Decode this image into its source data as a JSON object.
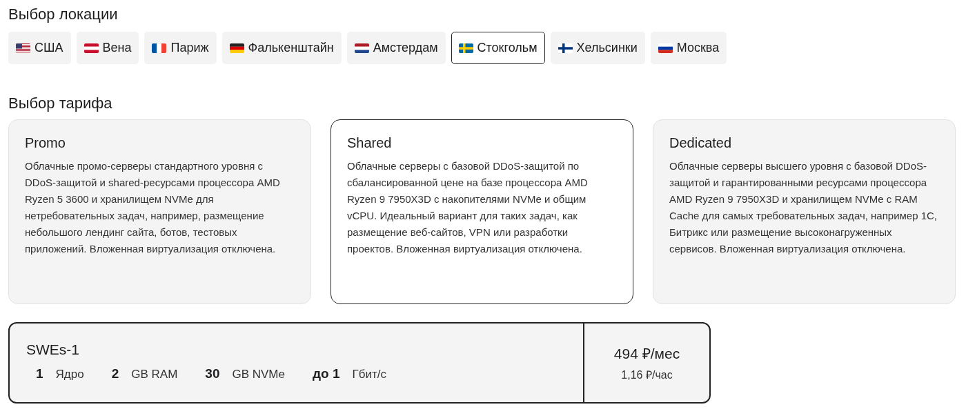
{
  "locations_title": "Выбор локации",
  "locations": [
    {
      "label": "США",
      "selected": false
    },
    {
      "label": "Вена",
      "selected": false
    },
    {
      "label": "Париж",
      "selected": false
    },
    {
      "label": "Фалькенштайн",
      "selected": false
    },
    {
      "label": "Амстердам",
      "selected": false
    },
    {
      "label": "Стокгольм",
      "selected": true
    },
    {
      "label": "Хельсинки",
      "selected": false
    },
    {
      "label": "Москва",
      "selected": false
    }
  ],
  "tariffs_title": "Выбор тарифа",
  "tariffs": [
    {
      "title": "Promo",
      "description": "Облачные промо-серверы стандартного уровня с DDoS-защитой и shared-ресурсами процессора AMD Ryzen 5 3600 и хранилищем NVMe для нетребовательных задач, например, размещение небольшого лендинг сайта, ботов, тестовых приложений. Вложенная виртуализация отключена.",
      "selected": false
    },
    {
      "title": "Shared",
      "description": "Облачные серверы с базовой DDoS-защитой по сбалансированной цене на базе процессора AMD Ryzen 9 7950X3D с накопителями NVMe и общим vCPU. Идеальный вариант для таких задач, как размещение веб-сайтов, VPN или разработки проектов. Вложенная виртуализация отключена.",
      "selected": true
    },
    {
      "title": "Dedicated",
      "description": "Облачные серверы высшего уровня с базовой DDoS-защитой и гарантированными ресурсами процессора AMD Ryzen 9 7950X3D и хранилищем NVMe с RAM Cache для самых требовательных задач, например 1С, Битрикс или размещение высоконагруженных сервисов. Вложенная виртуализация отключена.",
      "selected": false
    }
  ],
  "plan": {
    "name": "SWEs-1",
    "specs": [
      {
        "value": "1",
        "unit": "Ядро"
      },
      {
        "value": "2",
        "unit": "GB RAM"
      },
      {
        "value": "30",
        "unit": "GB NVMe"
      },
      {
        "value": "до 1",
        "unit": "Гбит/с"
      }
    ],
    "price_month": "494 ₽/мес",
    "price_hour": "1,16 ₽/час"
  }
}
